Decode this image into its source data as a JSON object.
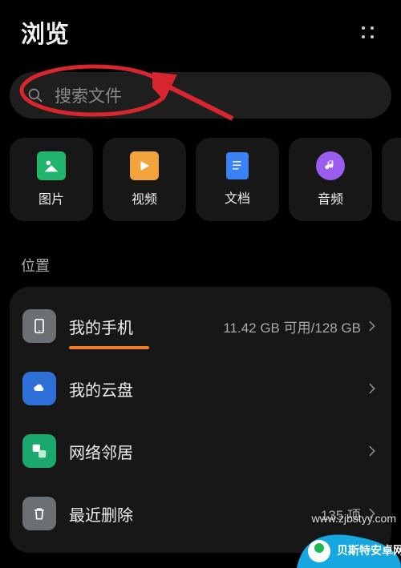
{
  "header": {
    "title": "浏览"
  },
  "search": {
    "placeholder": "搜索文件"
  },
  "categories": [
    {
      "label": "图片",
      "icon": "image-icon",
      "color": "#20b66d"
    },
    {
      "label": "视频",
      "icon": "video-icon",
      "color": "#f2a33c"
    },
    {
      "label": "文档",
      "icon": "document-icon",
      "color": "#3b82f6"
    },
    {
      "label": "音频",
      "icon": "audio-icon",
      "color": "#9b5cf0"
    }
  ],
  "locations_title": "位置",
  "locations": {
    "phone": {
      "label": "我的手机",
      "meta": "11.42 GB 可用/128 GB",
      "icon_bg": "#6b7075"
    },
    "cloud": {
      "label": "我的云盘",
      "icon_bg": "#2f6fd8"
    },
    "network": {
      "label": "网络邻居",
      "icon_bg": "#1ba86f"
    },
    "trash": {
      "label": "最近删除",
      "meta": "135 项",
      "icon_bg": "#6b7075"
    }
  },
  "watermark": {
    "site": "www.zjbstyy.com",
    "brand": "贝斯特安卓网"
  }
}
